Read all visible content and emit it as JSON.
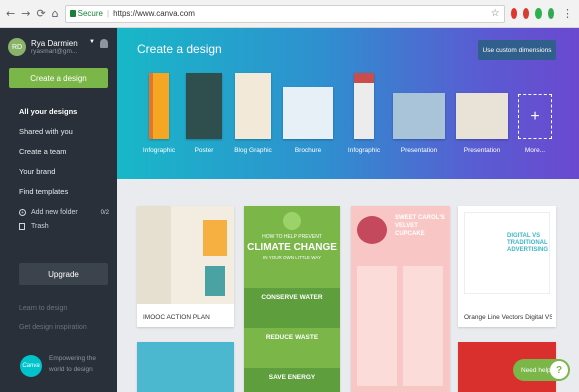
{
  "browser": {
    "url": "https://www.canva.com",
    "secure_label": "Secure"
  },
  "sidebar": {
    "user_name": "Rya Darmien",
    "user_email": "ryasmart@gm...",
    "create_button": "Create a design",
    "nav_items": [
      "All your designs",
      "Shared with you",
      "Create a team",
      "Your brand",
      "Find templates"
    ],
    "add_folder": "Add new folder",
    "folder_count": "0/2",
    "trash": "Trash",
    "upgrade": "Upgrade",
    "learn": "Learn to design",
    "inspiration": "Get design inspiration",
    "logo_text": "Canva",
    "tagline": "Empowering the world to design"
  },
  "hero": {
    "title": "Create a design",
    "custom_dimensions": "Use custom dimensions",
    "templates": [
      "Infographic",
      "Poster",
      "Blog Graphic",
      "Brochure",
      "Infographic",
      "Presentation",
      "Presentation",
      "More..."
    ]
  },
  "cards": {
    "card1_label": "IMOOC ACTION PLAN",
    "card2_top": "HOW TO HELP PREVENT",
    "card2_title": "CLIMATE CHANGE",
    "card2_sub": "IN YOUR OWN LITTLE WAY",
    "card2_row1": "CONSERVE WATER",
    "card2_row2": "REDUCE WASTE",
    "card2_row3": "SAVE ENERGY",
    "card3_title": "SWEET CAROL'S VELVET CUPCAKE",
    "card4_title": "DIGITAL VS TRADITIONAL ADVERTISING",
    "card4_label": "Orange Line Vectors Digital VS ..."
  },
  "help": {
    "label": "Need help",
    "icon": "?"
  },
  "colors": {
    "sidebar_bg": "#293039",
    "accent_green": "#7ab648",
    "hero_start": "#18b8c8",
    "hero_end": "#6a49cf"
  }
}
